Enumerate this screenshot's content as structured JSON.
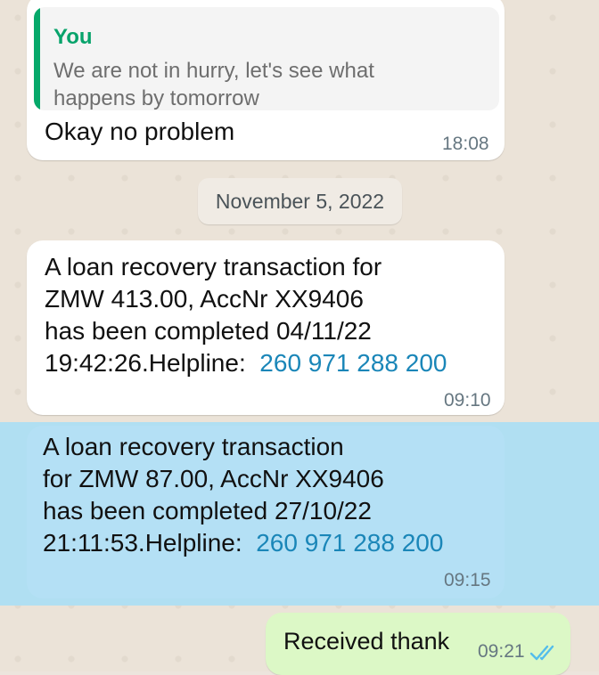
{
  "messages": {
    "first": {
      "quote_author": "You",
      "quote_text": "We are not in hurry, let's see what happens by tomorrow",
      "text": "Okay no problem",
      "time": "18:08"
    },
    "date_separator": "November 5, 2022",
    "second": {
      "line1": "A loan recovery transaction for",
      "line2": "ZMW 413.00, AccNr XX9406",
      "line3": "has been completed 04/11/22",
      "line4_prefix": "19:42:26.Helpline:",
      "phone": "260 971 288 200",
      "time": "09:10"
    },
    "third": {
      "line1": "A loan recovery transaction",
      "line2": "for ZMW 87.00, AccNr XX9406",
      "line3": "has been completed 27/10/22",
      "line4_prefix": "21:11:53.Helpline:",
      "phone": "260 971 288 200",
      "time": "09:15",
      "selected": true
    },
    "outgoing": {
      "text": "Received thank",
      "time": "09:21",
      "status_icon": "double-check-icon"
    }
  },
  "colors": {
    "quote_accent": "#06a96a",
    "link": "#1a86b8",
    "outgoing_bubble": "#dcf8c6",
    "selected_bubble": "#b4e0f5",
    "read_ticks": "#53bdeb"
  }
}
